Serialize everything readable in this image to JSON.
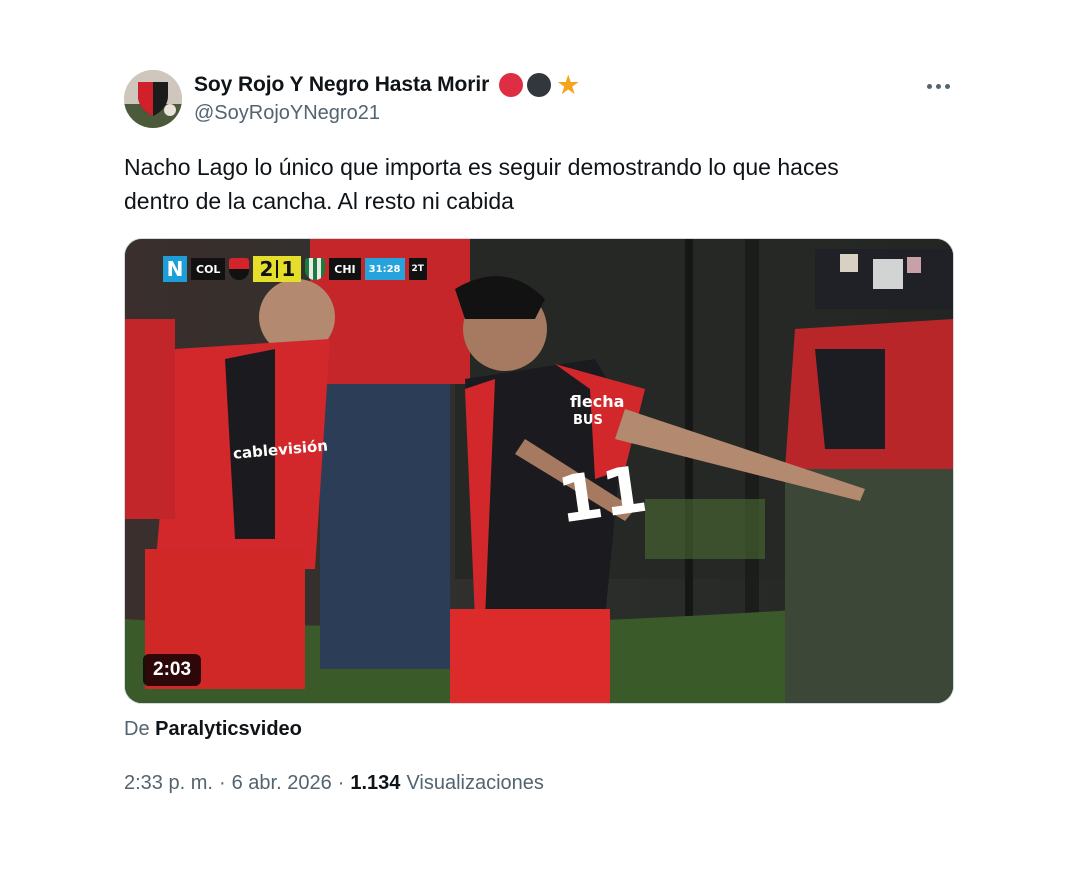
{
  "author": {
    "display_name": "Soy Rojo Y Negro Hasta Morir",
    "handle": "@SoyRojoYNegro21",
    "name_emojis": [
      "red-circle",
      "black-circle",
      "star"
    ]
  },
  "tweet": {
    "text_line1": "Nacho Lago lo único que importa es seguir demostrando lo que haces",
    "text_line2": "dentro de la cancha. Al resto ni cabida"
  },
  "video": {
    "duration": "2:03",
    "scorebug": {
      "channel_logo": "N",
      "home_team": "COL",
      "home_score": "2",
      "away_score": "1",
      "away_team": "CHI",
      "clock": "31:28",
      "half": "2T"
    },
    "player_shirt_text": "flecha BUS",
    "player_number": "11",
    "sponsor_text": "cablevisión"
  },
  "source": {
    "prefix": "De",
    "name": "Paralyticsvideo"
  },
  "meta": {
    "time": "2:33 p. m.",
    "separator": "·",
    "date": "6 abr. 2026",
    "views_count": "1.134",
    "views_label": "Visualizaciones"
  },
  "colors": {
    "text_primary": "#0f1419",
    "text_secondary": "#536471",
    "shirt_red": "#d22a2a",
    "shirt_black": "#1b1b1f",
    "scoreboard_yellow": "#e5de2a",
    "clock_blue": "#26a3dc"
  },
  "icons": [
    "more-options-icon",
    "play-duration-badge"
  ]
}
